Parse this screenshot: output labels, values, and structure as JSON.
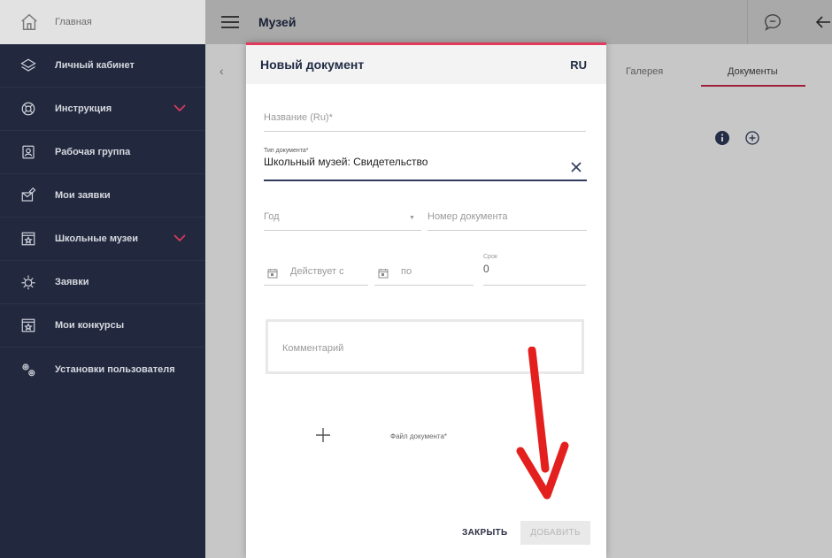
{
  "sidebar": {
    "home_label": "Главная",
    "items": [
      {
        "label": "Личный кабинет",
        "icon": "layers-icon",
        "expandable": false
      },
      {
        "label": "Инструкция",
        "icon": "lifebuoy-icon",
        "expandable": true
      },
      {
        "label": "Рабочая группа",
        "icon": "id-badge-icon",
        "expandable": false
      },
      {
        "label": "Мои заявки",
        "icon": "mail-edit-icon",
        "expandable": false
      },
      {
        "label": "Школьные музеи",
        "icon": "museum-icon",
        "expandable": true
      },
      {
        "label": "Заявки",
        "icon": "bug-gear-icon",
        "expandable": false
      },
      {
        "label": "Мои конкурсы",
        "icon": "museum-icon",
        "expandable": false
      },
      {
        "label": "Установки пользователя",
        "icon": "gears-icon",
        "expandable": false
      }
    ]
  },
  "topbar": {
    "title": "Музей"
  },
  "content": {
    "tabs": [
      "Галерея",
      "Документы"
    ],
    "active_tab": "Документы"
  },
  "modal": {
    "title": "Новый документ",
    "lang": "RU",
    "name_placeholder": "Название (Ru)*",
    "type_label": "Тип документа*",
    "type_value": "Школьный музей: Свидетельство",
    "year_placeholder": "Год",
    "docnum_placeholder": "Номер документа",
    "from_placeholder": "Действует с",
    "to_placeholder": "по",
    "term_label": "Срок",
    "term_value": "0",
    "comment_placeholder": "Комментарий",
    "file_label": "Файл документа*",
    "close_label": "ЗАКРЫТЬ",
    "add_label": "ДОБАВИТЬ"
  },
  "colors": {
    "sidebar_bg": "#22293f",
    "accent": "#e03a5c",
    "annotation_arrow": "#e4201f"
  }
}
